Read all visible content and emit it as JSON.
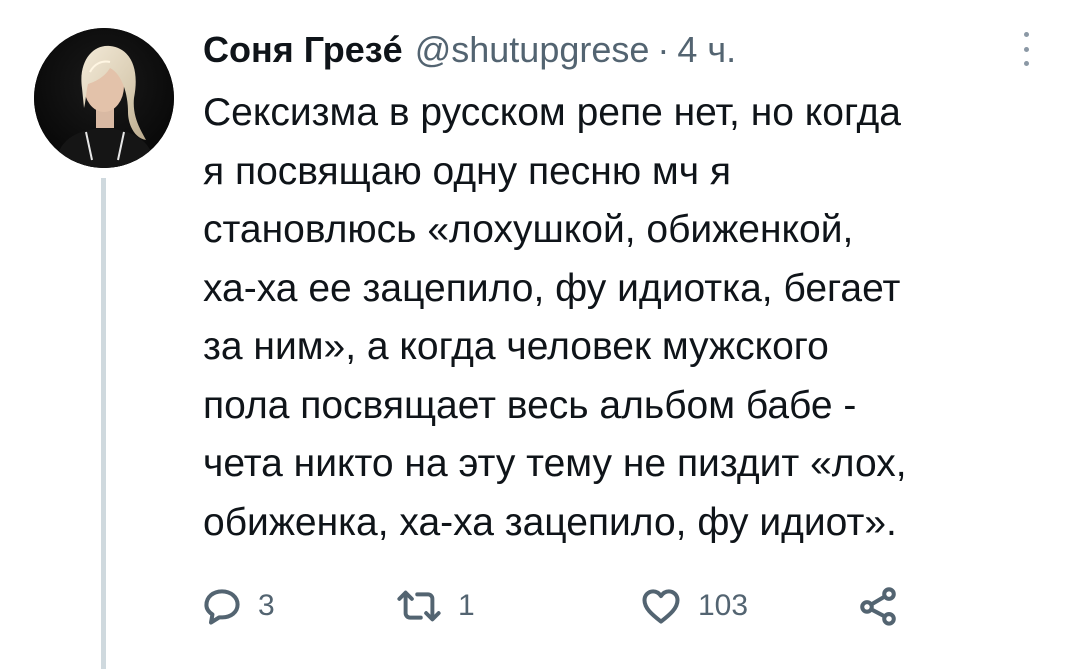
{
  "tweet": {
    "author_name": "Соня Грезé",
    "handle": "@shutupgrese",
    "separator": "·",
    "time": "4 ч.",
    "lines": [
      "Сексизма в русском репе нет, но когда",
      "я посвящаю одну песню мч я",
      "становлюсь «лохушкой, обиженкой,",
      "ха-ха ее зацепило, фу идиотка, бегает",
      "за ним», а когда человек мужского",
      "пола посвящает весь альбом бабе -",
      "чета никто на эту тему не пиздит «лох,",
      "обиженка, ха-ха зацепило, фу идиот»."
    ]
  },
  "actions": {
    "reply_icon": "reply-icon",
    "reply_count": "3",
    "retweet_icon": "retweet-icon",
    "retweet_count": "1",
    "like_icon": "heart-icon",
    "like_count": "103",
    "share_icon": "share-icon"
  },
  "colors": {
    "text": "#0f1419",
    "secondary": "#536471",
    "thread_line": "#cfd9de",
    "background": "#ffffff"
  }
}
